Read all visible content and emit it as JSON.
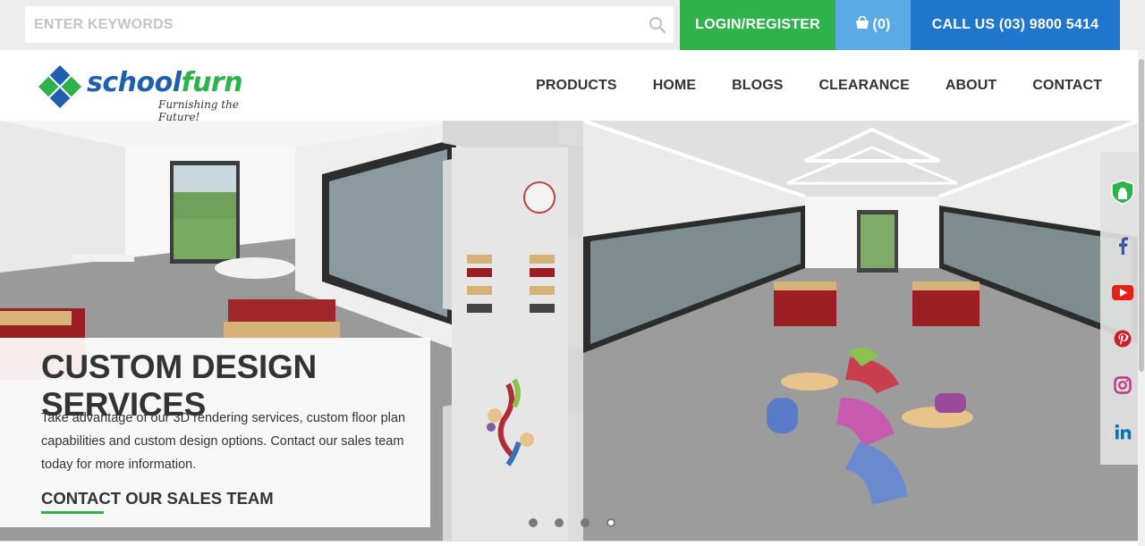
{
  "search": {
    "placeholder": "ENTER KEYWORDS"
  },
  "topbar": {
    "login_label": "LOGIN/REGISTER",
    "cart_count": "(0)",
    "call_label": "CALL US (03) 9800 5414",
    "colors": {
      "login": "#2db34a",
      "cart": "#5aaae6",
      "call": "#1f76cc"
    }
  },
  "logo": {
    "name_part1": "school",
    "name_part2": "furn",
    "tagline": "Furnishing the Future!"
  },
  "nav": [
    "PRODUCTS",
    "HOME",
    "BLOGS",
    "CLEARANCE",
    "ABOUT",
    "CONTACT"
  ],
  "hero": {
    "title": "CUSTOM DESIGN SERVICES",
    "text": "Take advantage of our 3D rendering services, custom floor plan capabilities and custom design options. Contact our sales team today for more information.",
    "cta": "CONTACT OUR SALES TEAM",
    "slides": 4,
    "active_slide": 4
  },
  "social": [
    "shield-icon",
    "facebook-icon",
    "youtube-icon",
    "pinterest-icon",
    "instagram-icon",
    "linkedin-icon"
  ]
}
